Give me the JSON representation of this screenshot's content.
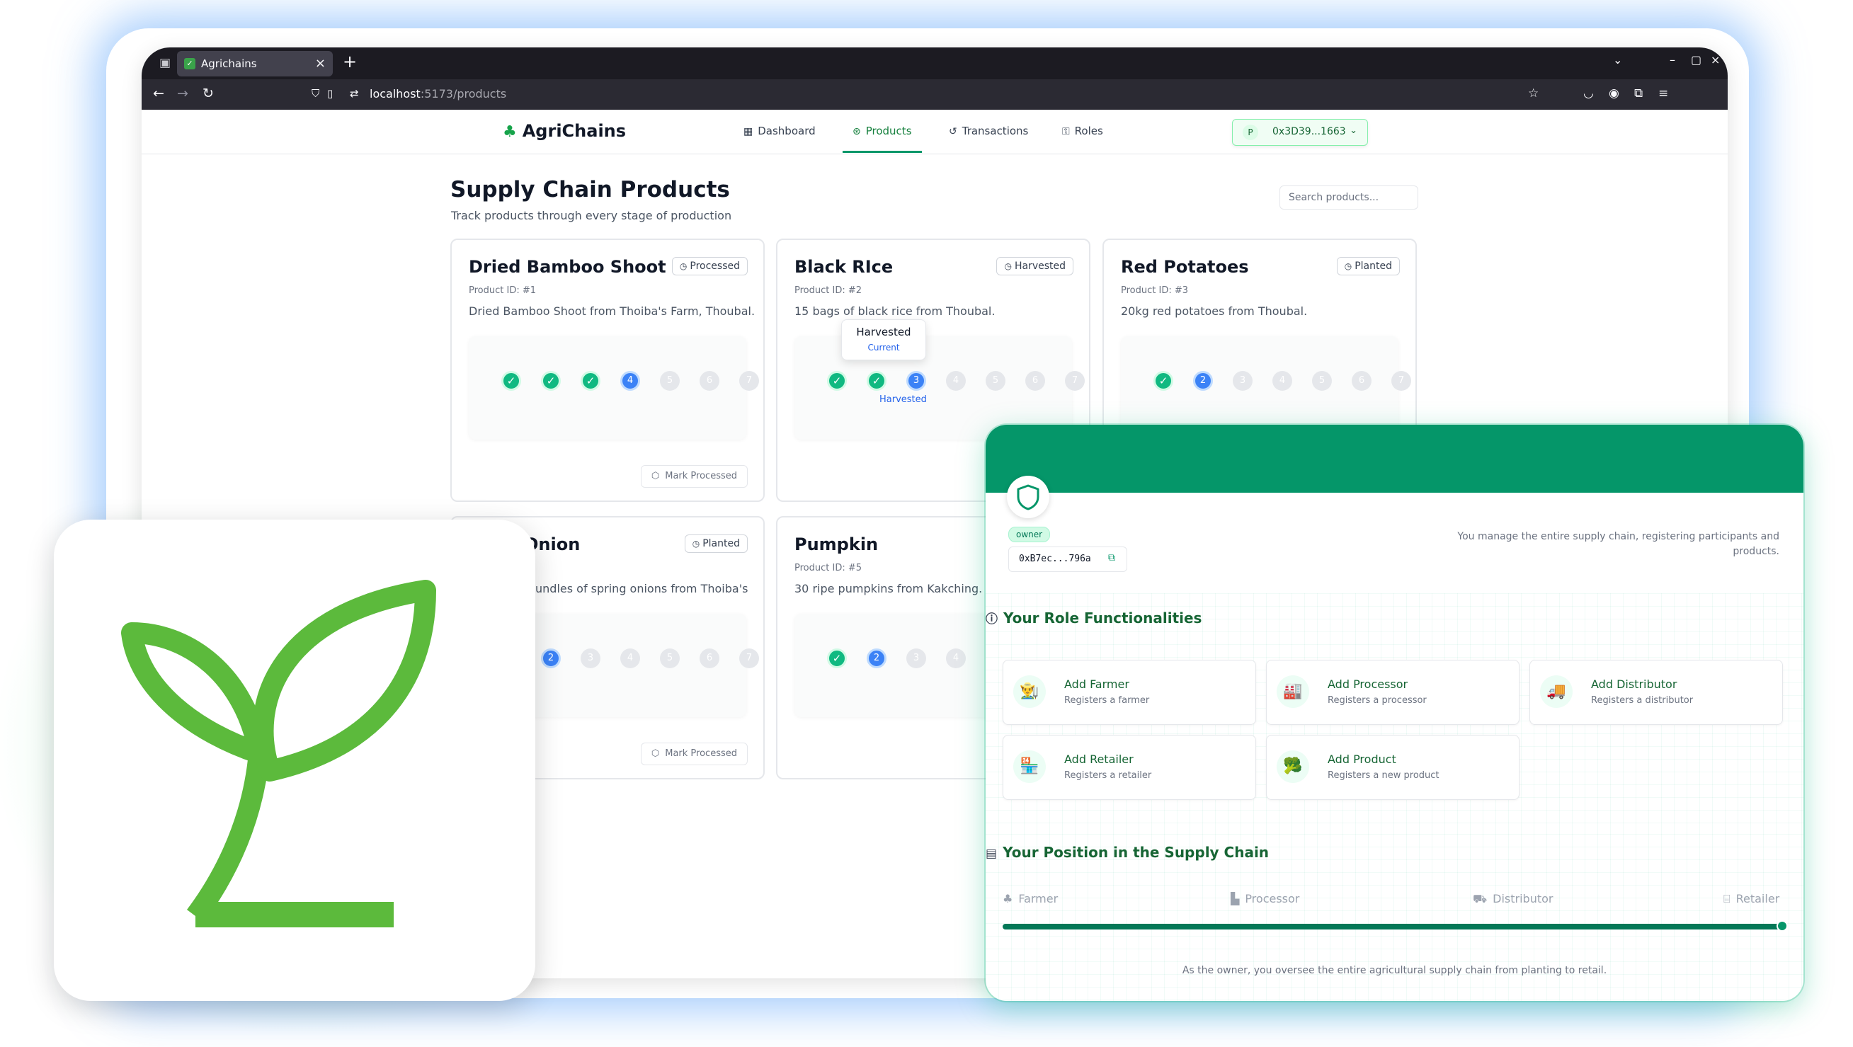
{
  "browser": {
    "tab_title": "Agrichains",
    "url_host": "localhost",
    "url_path": ":5173/products"
  },
  "header": {
    "logo": "AgriChains",
    "nav": [
      "Dashboard",
      "Products",
      "Transactions",
      "Roles"
    ],
    "active_nav": "Products",
    "account_initial": "P",
    "account_address": "0x3D39...1663"
  },
  "page": {
    "title": "Supply Chain Products",
    "subtitle": "Track products through every stage of production",
    "search_placeholder": "Search products..."
  },
  "products": [
    {
      "name": "Dried Bamboo Shoot",
      "id_label": "Product ID: #1",
      "description": "Dried Bamboo Shoot from Thoiba's Farm, Thoubal.",
      "status": "Processed",
      "current_step": 4,
      "action": "Mark Processed"
    },
    {
      "name": "Black RIce",
      "id_label": "Product ID: #2",
      "description": "15 bags of black rice from Thoubal.",
      "status": "Harvested",
      "current_step": 3,
      "current_step_label": "Harvested",
      "tooltip_title": "Harvested",
      "tooltip_sub": "Current"
    },
    {
      "name": "Red Potatoes",
      "id_label": "Product ID: #3",
      "description": "20kg red potatoes from Thoubal.",
      "status": "Planted",
      "current_step": 2
    },
    {
      "name": "Onion",
      "status": "Planted",
      "description": "undles of spring onions from Thoiba's",
      "current_step": 2,
      "action": "Mark Processed"
    },
    {
      "name": "Pumpkin",
      "id_label": "Product ID: #5",
      "description": "30 ripe pumpkins from Kakching.",
      "current_step": 2
    }
  ],
  "steps": {
    "numbers": [
      "1",
      "2",
      "3",
      "4",
      "5",
      "6",
      "7"
    ]
  },
  "role_panel": {
    "role": "owner",
    "address": "0xB7ec...796a",
    "summary": "You manage the entire supply chain, registering participants and products.",
    "functionalities_title": "Your Role Functionalities",
    "functionalities": [
      {
        "title": "Add Farmer",
        "subtitle": "Registers a farmer",
        "icon": "farmer-emoji"
      },
      {
        "title": "Add Processor",
        "subtitle": "Registers a processor",
        "icon": "factory-emoji"
      },
      {
        "title": "Add Distributor",
        "subtitle": "Registers a distributor",
        "icon": "truck-emoji"
      },
      {
        "title": "Add Retailer",
        "subtitle": "Registers a retailer",
        "icon": "store-emoji"
      },
      {
        "title": "Add Product",
        "subtitle": "Registers a new product",
        "icon": "broccoli-emoji"
      }
    ],
    "position_title": "Your Position in the Supply Chain",
    "positions": [
      "Farmer",
      "Processor",
      "Distributor",
      "Retailer"
    ],
    "position_progress": 1.0,
    "footer": "As the owner, you oversee the entire agricultural supply chain from planting to retail."
  },
  "colors": {
    "brand_green": "#059669",
    "step_done": "#10b981",
    "step_current": "#3b82f6",
    "logo_icon_green": "#5cba3c"
  }
}
